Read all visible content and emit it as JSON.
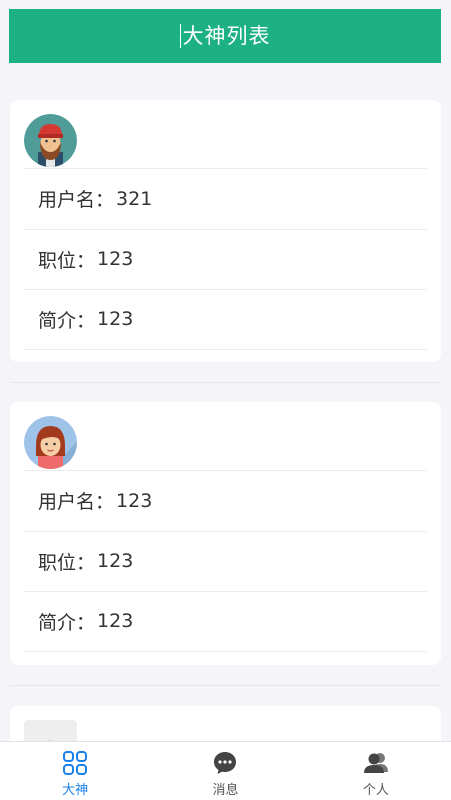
{
  "header": {
    "title": "大神列表"
  },
  "cards": [
    {
      "avatar": "bearded-man-avatar",
      "rows": [
        {
          "key": "用户名：",
          "value": "321"
        },
        {
          "key": "职位：",
          "value": "123"
        },
        {
          "key": "简介：",
          "value": "123"
        }
      ]
    },
    {
      "avatar": "woman-avatar",
      "rows": [
        {
          "key": "用户名：",
          "value": "123"
        },
        {
          "key": "职位：",
          "value": "123"
        },
        {
          "key": "简介：",
          "value": "123"
        }
      ]
    },
    {
      "avatar": "placeholder-avatar"
    }
  ],
  "tabbar": {
    "tabs": [
      {
        "label": "大神",
        "icon": "grid-icon",
        "active": true
      },
      {
        "label": "消息",
        "icon": "chat-icon",
        "active": false
      },
      {
        "label": "个人",
        "icon": "users-icon",
        "active": false
      }
    ]
  },
  "colors": {
    "header": "#1db082",
    "active_tab": "#1a80ea",
    "background": "#f5f5f9"
  }
}
